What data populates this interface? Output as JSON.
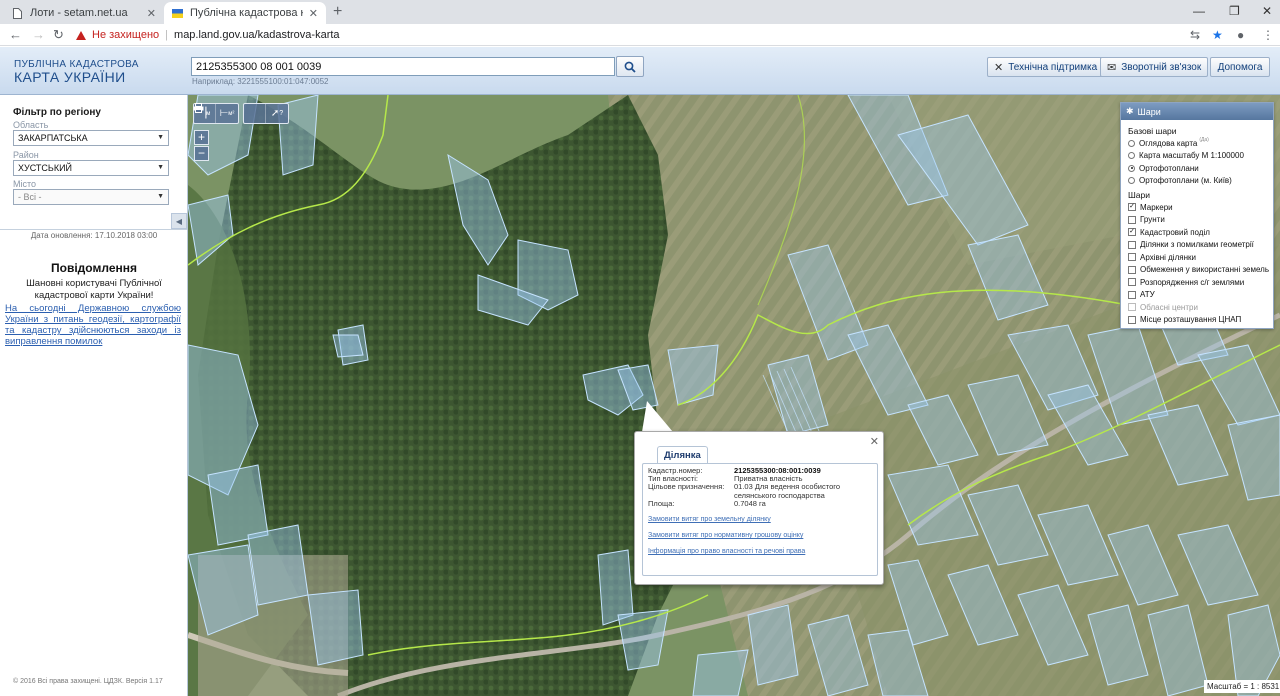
{
  "browser": {
    "tabs": [
      {
        "title": "Лоти - setam.net.ua",
        "active": false
      },
      {
        "title": "Публічна кадастрова карта Укр",
        "active": true
      }
    ],
    "security_label": "Не захищено",
    "url": "map.land.gov.ua/kadastrova-karta"
  },
  "header": {
    "logo_line1": "ПУБЛІЧНА КАДАСТРОВА",
    "logo_line2": "КАРТА УКРАЇНИ",
    "search_value": "2125355300 08 001 0039",
    "search_hint": "Наприклад: 3221555100:01:047:0052",
    "buttons": {
      "support": "Технічна підтримка",
      "feedback": "Зворотній зв'язок",
      "help": "Допомога"
    }
  },
  "left_panel": {
    "filter_title": "Фільтр по регіону",
    "region_label": "Область",
    "region_value": "ЗАКАРПАТСЬКА",
    "district_label": "Район",
    "district_value": "ХУСТСЬКИЙ",
    "city_label": "Місто",
    "city_value": "- Всі -",
    "update_date": "Дата оновлення: 17.10.2018 03:00",
    "notice_title": "Повідомлення",
    "notice_greeting": "Шановні користувачі Публічної кадастрової карти України!",
    "notice_link": "На сьогодні Державною службою України з питань геодезії, картографії та кадастру здійснюються заходи із виправлення помилок",
    "copyright": "© 2016 Всі права захищені. ЦДЗК. Версія 1.17"
  },
  "map": {
    "toolbar": {
      "measure_label": "м",
      "area_label": "м²",
      "info_label": "?"
    },
    "zoom_in": "+",
    "zoom_out": "−",
    "scale": "Масштаб = 1 : 8531"
  },
  "layers": {
    "title": "Шари",
    "base_title": "Базові шари",
    "base": [
      {
        "label": "Оглядова карта",
        "sup": "(Да)",
        "selected": false
      },
      {
        "label": "Карта масштабу М 1:100000",
        "selected": false
      },
      {
        "label": "Ортофотоплани",
        "selected": true
      },
      {
        "label": "Ортофотоплани (м. Київ)",
        "selected": false
      }
    ],
    "overlay_title": "Шари",
    "overlays": [
      {
        "label": "Маркери",
        "checked": true,
        "enabled": true
      },
      {
        "label": "Грунти",
        "checked": false,
        "enabled": true
      },
      {
        "label": "Кадастровий поділ",
        "checked": true,
        "enabled": true
      },
      {
        "label": "Ділянки з помилками геометрії",
        "checked": false,
        "enabled": true
      },
      {
        "label": "Архівні ділянки",
        "checked": false,
        "enabled": true
      },
      {
        "label": "Обмеження у використанні земель",
        "checked": false,
        "enabled": true
      },
      {
        "label": "Розпорядження с/г землями",
        "checked": false,
        "enabled": true
      },
      {
        "label": "АТУ",
        "checked": false,
        "enabled": true
      },
      {
        "label": "Обласні центри",
        "checked": false,
        "enabled": false
      },
      {
        "label": "Місце розташування ЦНАП",
        "checked": false,
        "enabled": true
      }
    ]
  },
  "parcel_popup": {
    "tab": "Ділянка",
    "rows": [
      {
        "label": "Кадастр.номер:",
        "value": "2125355300:08:001:0039"
      },
      {
        "label": "Тип власності:",
        "value": "Приватна власність"
      },
      {
        "label": "Цільове призначення:",
        "value": "01.03 Для ведення особистого селянського господарства"
      },
      {
        "label": "Площа:",
        "value": "0.7048 га"
      }
    ],
    "links": [
      "Замовити витяг про земельну ділянку",
      "Замовити витяг про нормативну грошову оцінку",
      "Інформація про право власності та речові права"
    ]
  },
  "colors": {
    "accent": "#1f4e8c",
    "link": "#2b5fb0",
    "parcel_fill": "#9cc8f0",
    "parcel_stroke": "#bfe0ff",
    "boundary_line": "#b6e84a",
    "forest": "#3f5a32",
    "field": "#8b8f6a"
  }
}
